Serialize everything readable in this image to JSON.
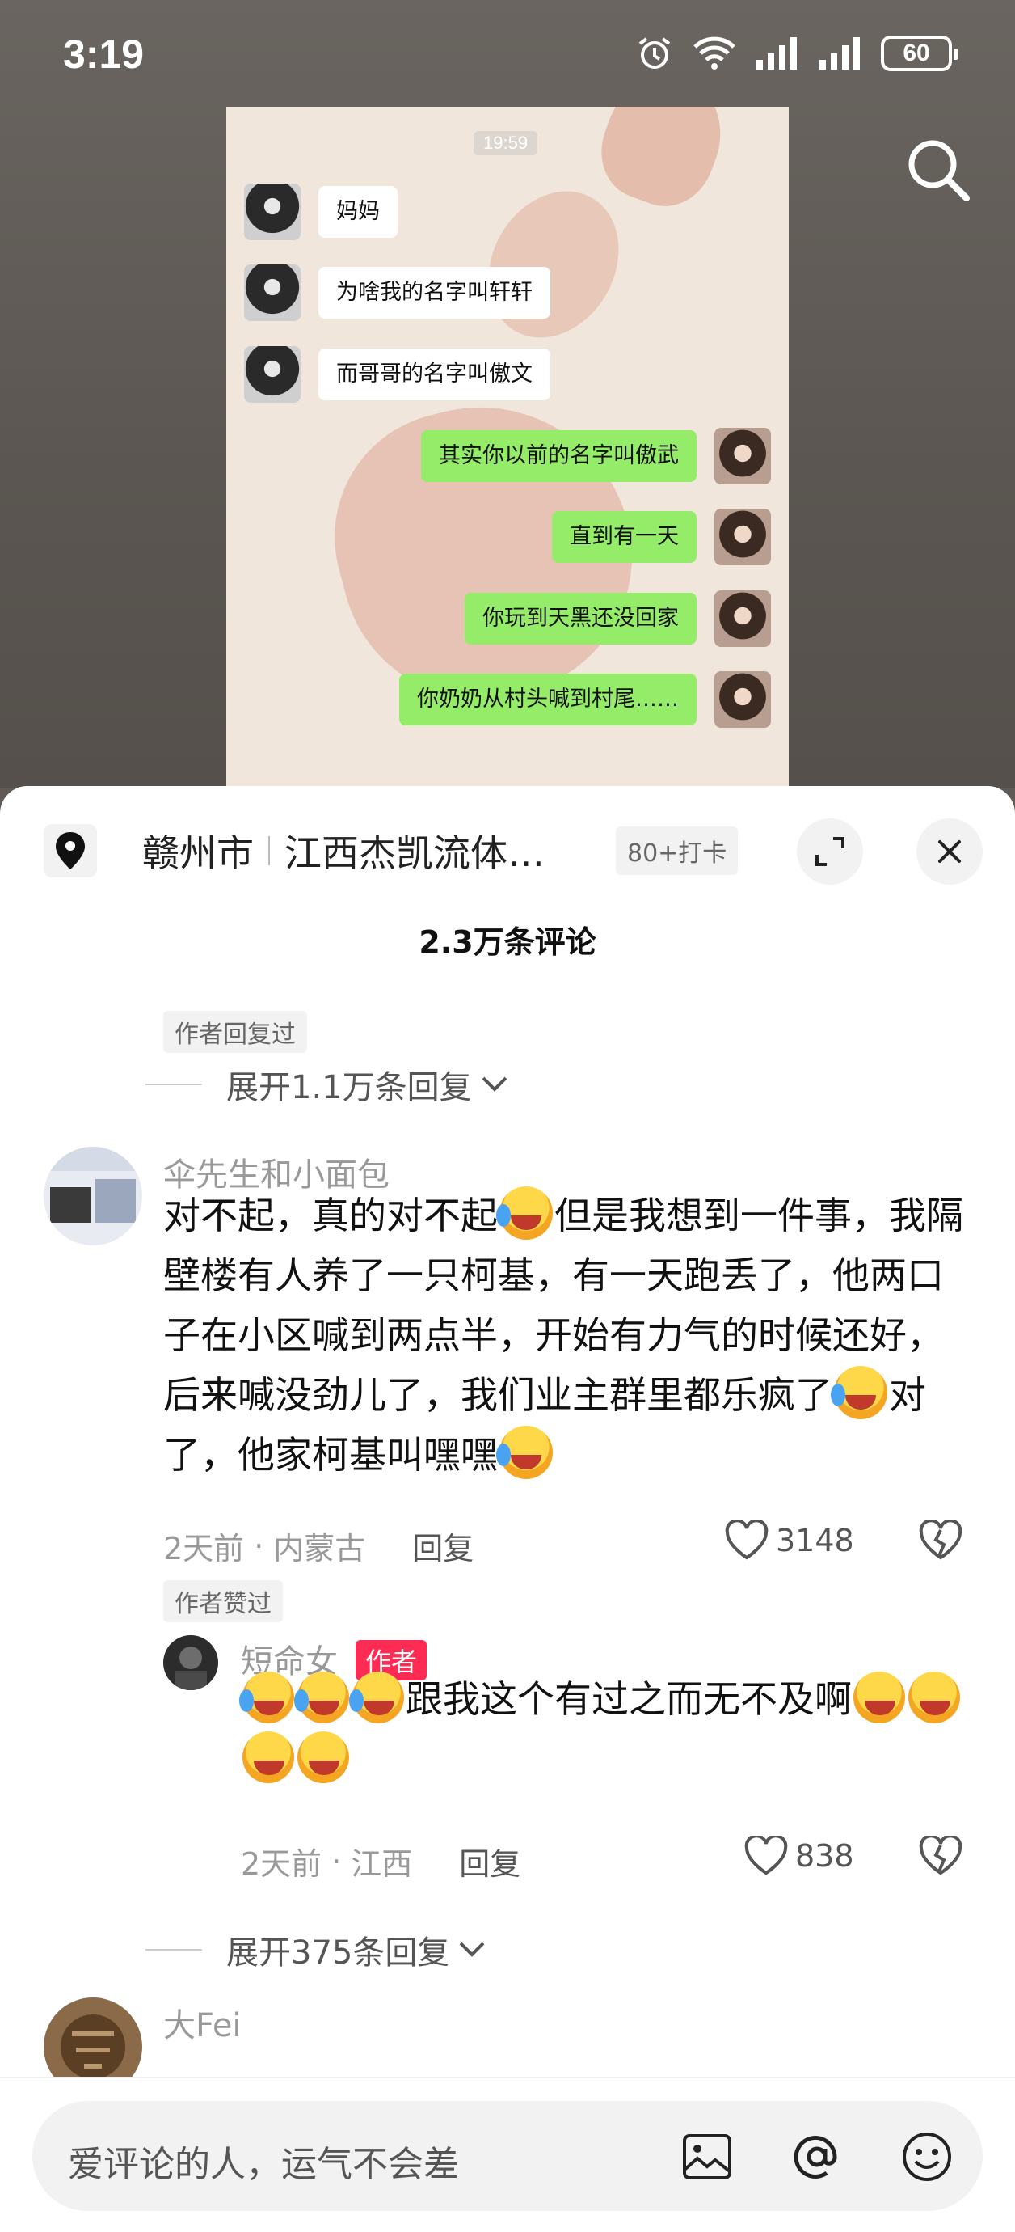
{
  "status_bar": {
    "time": "3:19",
    "battery": "60"
  },
  "chat": {
    "time": "19:59",
    "messages": [
      {
        "side": "left",
        "text": "妈妈"
      },
      {
        "side": "left",
        "text": "为啥我的名字叫轩轩"
      },
      {
        "side": "left",
        "text": "而哥哥的名字叫傲文"
      },
      {
        "side": "right",
        "text": "其实你以前的名字叫傲武"
      },
      {
        "side": "right",
        "text": "直到有一天"
      },
      {
        "side": "right",
        "text": "你玩到天黑还没回家"
      },
      {
        "side": "right",
        "text": "你奶奶从村头喊到村尾……"
      }
    ]
  },
  "location": {
    "city": "赣州市",
    "name": "江西杰凯流体…",
    "tag": "80+打卡"
  },
  "comments_header": {
    "count": "2.3万条评论"
  },
  "prev_thread": {
    "tag": "作者回复过",
    "expand": "展开1.1万条回复"
  },
  "comment1": {
    "name": "伞先生和小面包",
    "text_parts": [
      "对不起，真的对不起",
      "但是我想到一件事，我隔壁楼有人养了一只柯基，有一天跑丢了，他两口子在小区喊到两点半，开始有力气的时候还好，后来喊没劲儿了，我们业主群里都乐疯了",
      "对了，他家柯基叫嘿嘿"
    ],
    "time": "2天前",
    "location": "内蒙古",
    "reply": "回复",
    "likes": "3148",
    "tag": "作者赞过"
  },
  "reply1": {
    "name": "短命女",
    "badge": "作者",
    "text": "跟我这个有过之而无不及啊",
    "time": "2天前",
    "location": "江西",
    "reply": "回复",
    "likes": "838"
  },
  "expand2": "展开375条回复",
  "comment2": {
    "name": "大Fei"
  },
  "input": {
    "placeholder": "爱评论的人，运气不会差"
  },
  "icons": [
    "location-pin-icon",
    "search-icon",
    "expand-icon",
    "close-icon",
    "chevron-down-icon",
    "heart-icon",
    "broken-heart-icon",
    "image-icon",
    "at-icon",
    "emoji-icon",
    "laugh-cry-emoji",
    "grin-emoji"
  ]
}
